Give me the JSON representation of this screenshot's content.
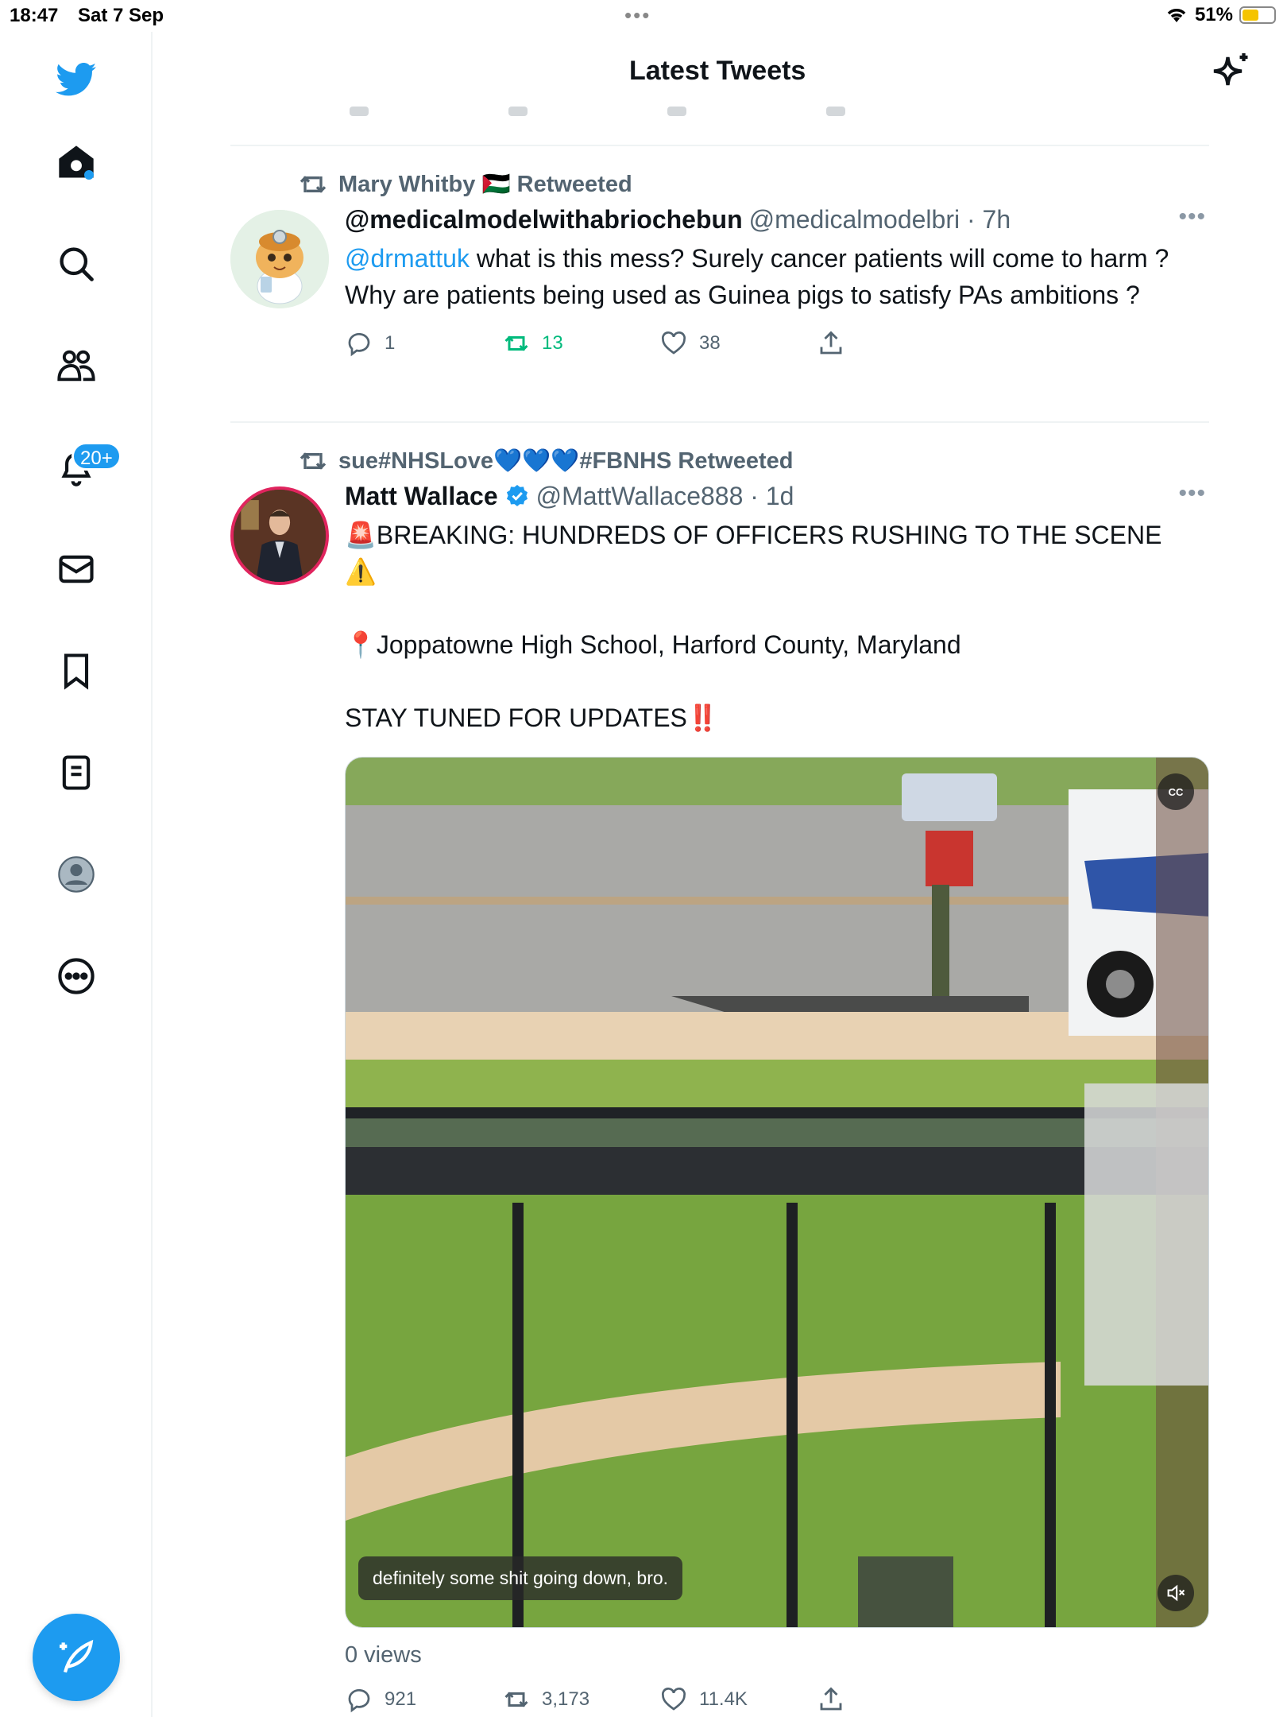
{
  "status_bar": {
    "time": "18:47",
    "date": "Sat 7 Sep",
    "dots": "•••",
    "battery": "51%",
    "battery_level": 0.51
  },
  "header": {
    "title": "Latest Tweets"
  },
  "sidebar": {
    "items": [
      "twitter-logo",
      "home",
      "search",
      "communities",
      "notifications",
      "messages",
      "bookmarks",
      "lists",
      "profile",
      "more"
    ],
    "notifications_badge": "20+"
  },
  "tweets": [
    {
      "retweeted_by": "Mary Whitby 🇵🇸 Retweeted",
      "author_name": "@medicalmodelwithabriochebun",
      "author_handle": "@medicalmodelbri · 7h",
      "text_mention": "@drmattuk",
      "text_line1": " what is this mess? Surely cancer patients will come to harm ?",
      "text_line2": "Why are patients being used as Guinea pigs to satisfy PAs ambitions ?",
      "replies": "1",
      "retweets": "13",
      "likes": "38",
      "more": "•••"
    },
    {
      "retweeted_by": "sue#NHSLove💙💙💙#FBNHS Retweeted",
      "author_name": "Matt Wallace",
      "author_handle": "@MattWallace888 · 1d",
      "text_line1": "🚨BREAKING: HUNDREDS OF OFFICERS RUSHING TO THE SCENE ⚠️",
      "text_line2": "📍Joppatowne High School, Harford County, Maryland",
      "text_line3": "STAY TUNED FOR UPDATES‼️",
      "video_caption": "definitely some shit going down, bro.",
      "cc_label": "CC",
      "views": "0 views",
      "replies": "921",
      "retweets": "3,173",
      "likes": "11.4K",
      "more": "•••"
    }
  ],
  "colors": {
    "accent": "#1d9bf0",
    "retweet_green": "#00ba7c",
    "secondary_text": "#536471"
  }
}
